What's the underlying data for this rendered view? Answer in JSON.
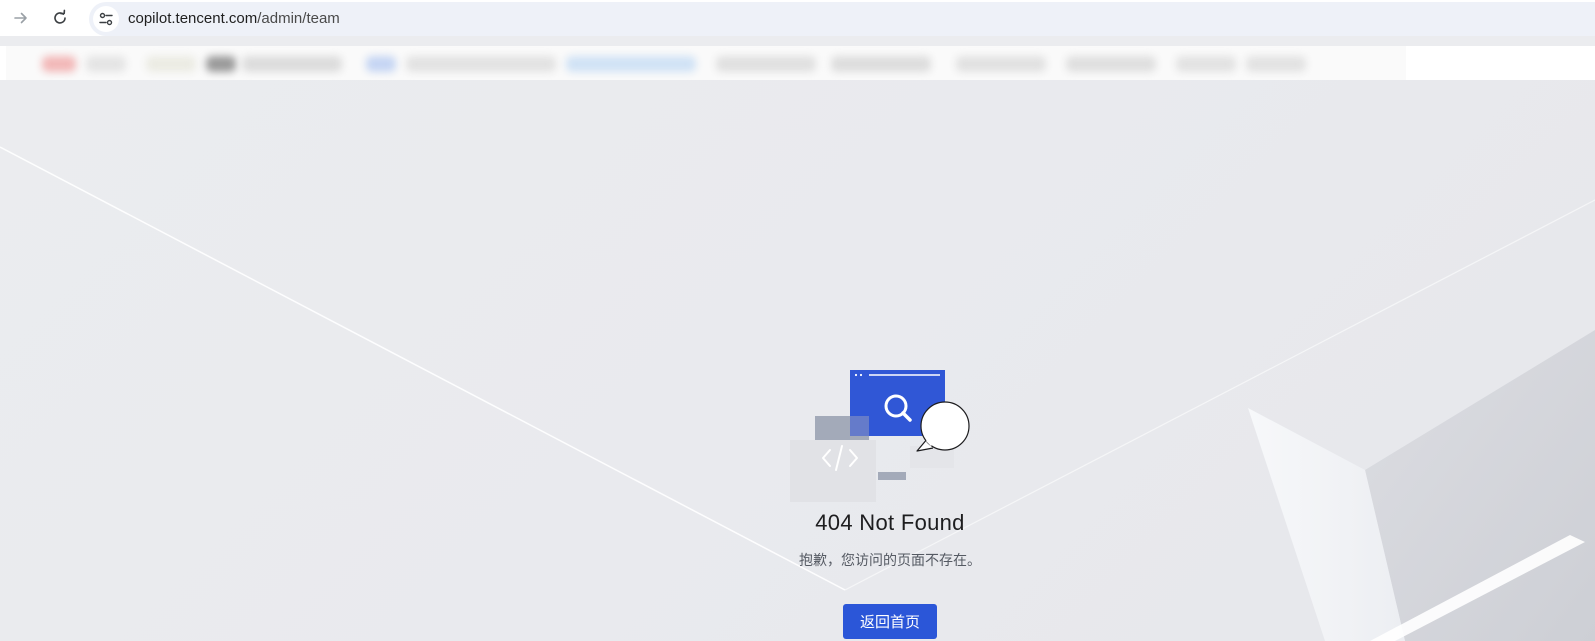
{
  "browser": {
    "url_host": "copilot.tencent.com",
    "url_path": "/admin/team",
    "icons": {
      "forward": "arrow-right-icon",
      "reload": "reload-icon",
      "site_info": "tune-icon"
    }
  },
  "error_page": {
    "title": "404 Not Found",
    "message": "抱歉，您访问的页面不存在。",
    "home_button_label": "返回首页"
  },
  "colors": {
    "accent": "#2b56d8",
    "illustration_blue": "#3057d6",
    "illustration_gray": "#a3aab9"
  }
}
